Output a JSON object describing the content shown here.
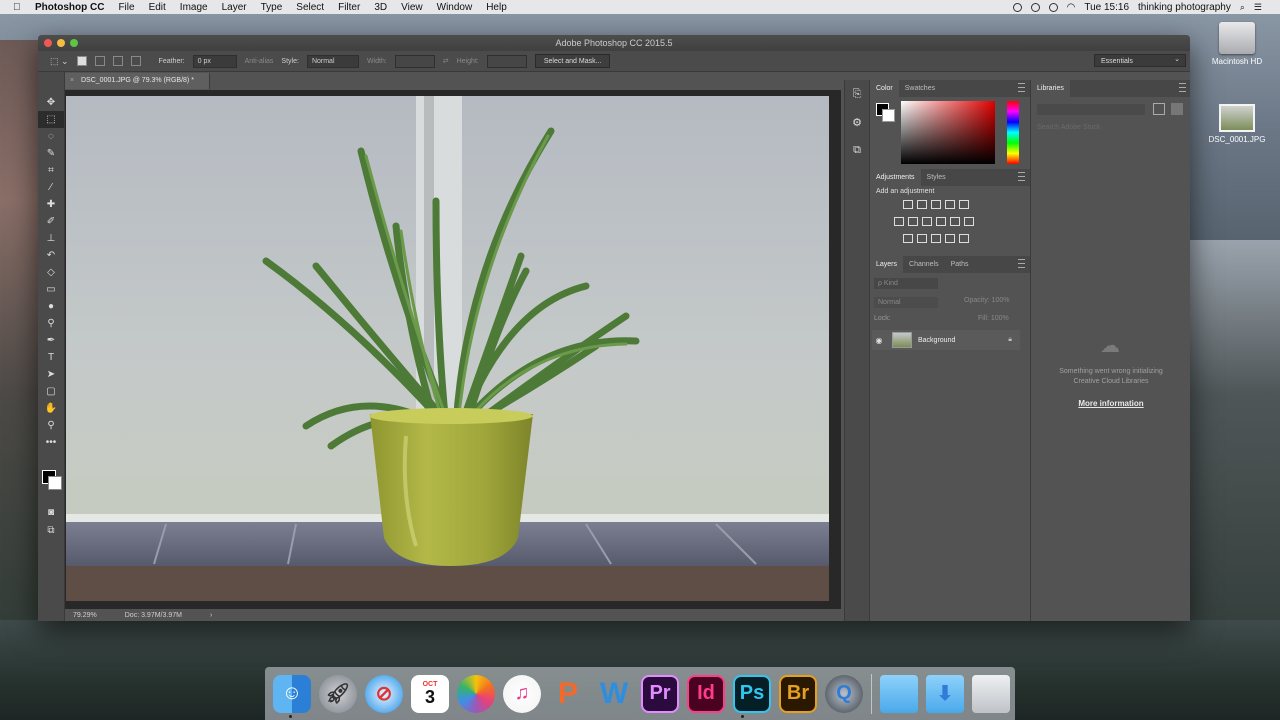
{
  "menubar": {
    "apple": "",
    "app_name": "Photoshop CC",
    "items": [
      "File",
      "Edit",
      "Image",
      "Layer",
      "Type",
      "Select",
      "Filter",
      "3D",
      "View",
      "Window",
      "Help"
    ],
    "clock": "Tue 15:16",
    "user": "thinking photography"
  },
  "desktop": {
    "icons": [
      {
        "label": "Macintosh HD",
        "icon": "hard-drive-icon"
      },
      {
        "label": "DSC_0001.JPG",
        "icon": "jpg-file-icon"
      }
    ]
  },
  "window": {
    "title": "Adobe Photoshop CC 2015.5",
    "options_bar": {
      "feather_label": "Feather:",
      "feather_value": "0 px",
      "antialias": "Anti-alias",
      "style_label": "Style:",
      "style_value": "Normal",
      "width_label": "Width:",
      "height_label": "Height:",
      "select_mask_button": "Select and Mask...",
      "workspace": "Essentials"
    },
    "document_tab": "DSC_0001.JPG @ 79.3% (RGB/8) *",
    "status": {
      "zoom": "79.29%",
      "doc": "Doc: 3.97M/3.97M",
      "arrow": "›"
    },
    "panels": {
      "color_tabs": [
        "Color",
        "Swatches"
      ],
      "adjustments_tabs": [
        "Adjustments",
        "Styles"
      ],
      "adjustments_title": "Add an adjustment",
      "layers_tabs": [
        "Layers",
        "Channels",
        "Paths"
      ],
      "layers_filter": "ρ Kind",
      "blend_mode": "Normal",
      "opacity_label": "Opacity: 100%",
      "lock_label": "Lock:",
      "fill_label": "Fill: 100%",
      "layer_name": "Background",
      "libraries_tab": "Libraries",
      "library_search": "Search Adobe Stock",
      "library_message_1": "Something went wrong initializing",
      "library_message_2": "Creative Cloud Libraries",
      "library_link": "More information"
    }
  },
  "dock": {
    "calendar_month": "OCT",
    "calendar_day": "3",
    "apps": [
      "Finder",
      "Launchpad",
      "Safari",
      "Calendar",
      "Photos",
      "iTunes",
      "Pages",
      "Word",
      "Premiere",
      "InDesign",
      "Photoshop",
      "Bridge",
      "QuickTime",
      "Folder",
      "Downloads",
      "Trash"
    ],
    "pr": "Pr",
    "id": "Id",
    "ps": "Ps",
    "br": "Br"
  },
  "colors": {
    "ps_bg": "#535353",
    "accent": "#31a8ff"
  }
}
